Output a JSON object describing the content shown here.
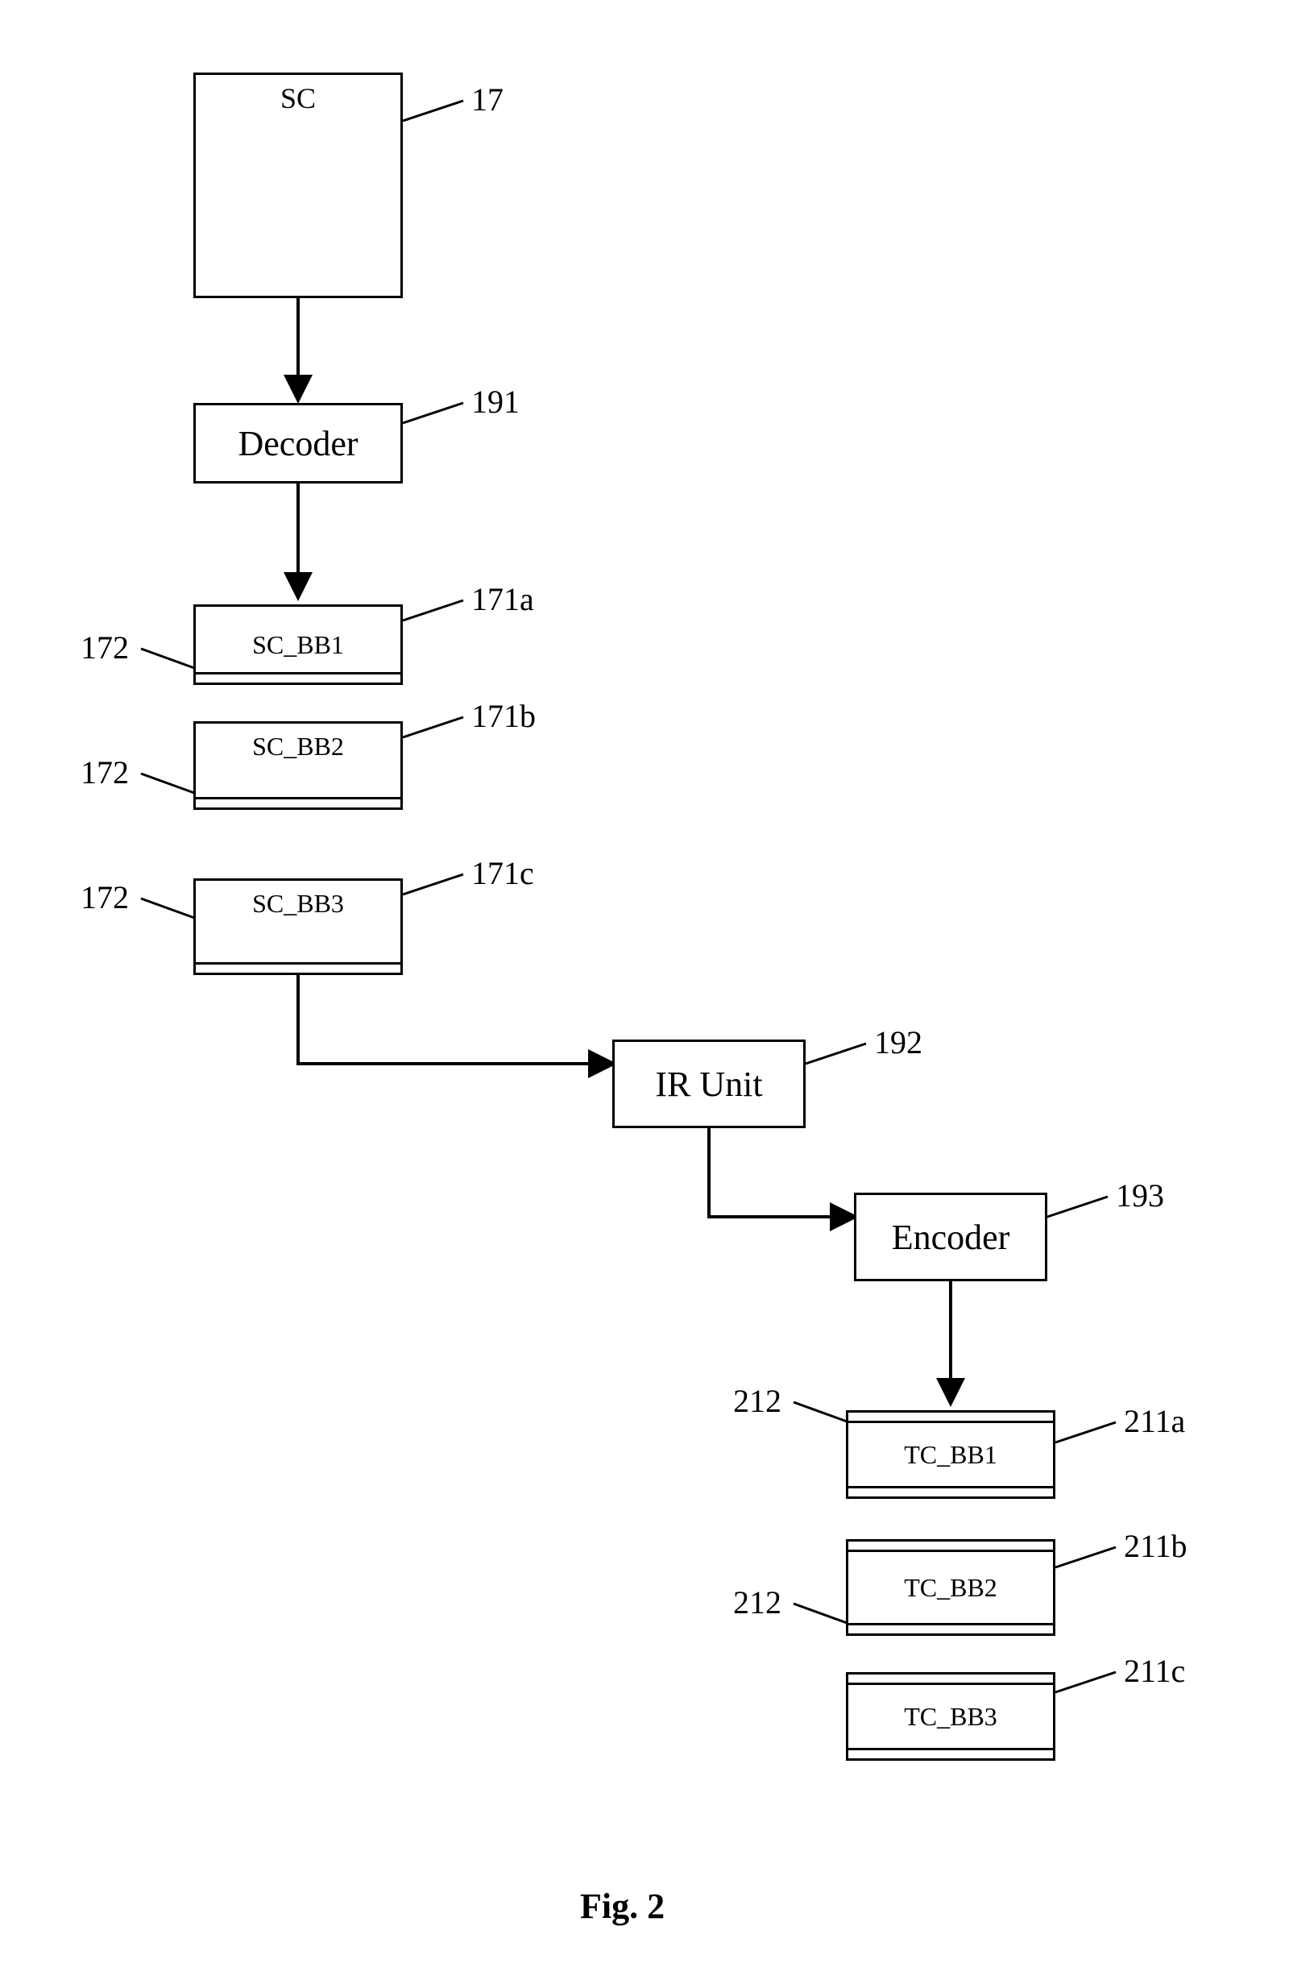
{
  "figure_caption": "Fig. 2",
  "nodes": {
    "sc": {
      "text": "SC",
      "ref": "17"
    },
    "decoder": {
      "text": "Decoder",
      "ref": "191"
    },
    "sc_bb1": {
      "text": "SC_BB1",
      "ref": "171a",
      "left_ref": "172"
    },
    "sc_bb2": {
      "text": "SC_BB2",
      "ref": "171b",
      "left_ref": "172"
    },
    "sc_bb3": {
      "text": "SC_BB3",
      "ref": "171c",
      "left_ref": "172"
    },
    "ir_unit": {
      "text": "IR Unit",
      "ref": "192"
    },
    "encoder": {
      "text": "Encoder",
      "ref": "193"
    },
    "tc_bb1": {
      "text": "TC_BB1",
      "ref": "211a",
      "left_ref": "212"
    },
    "tc_bb2": {
      "text": "TC_BB2",
      "ref": "211b",
      "left_ref": "212"
    },
    "tc_bb3": {
      "text": "TC_BB3",
      "ref": "211c"
    }
  }
}
